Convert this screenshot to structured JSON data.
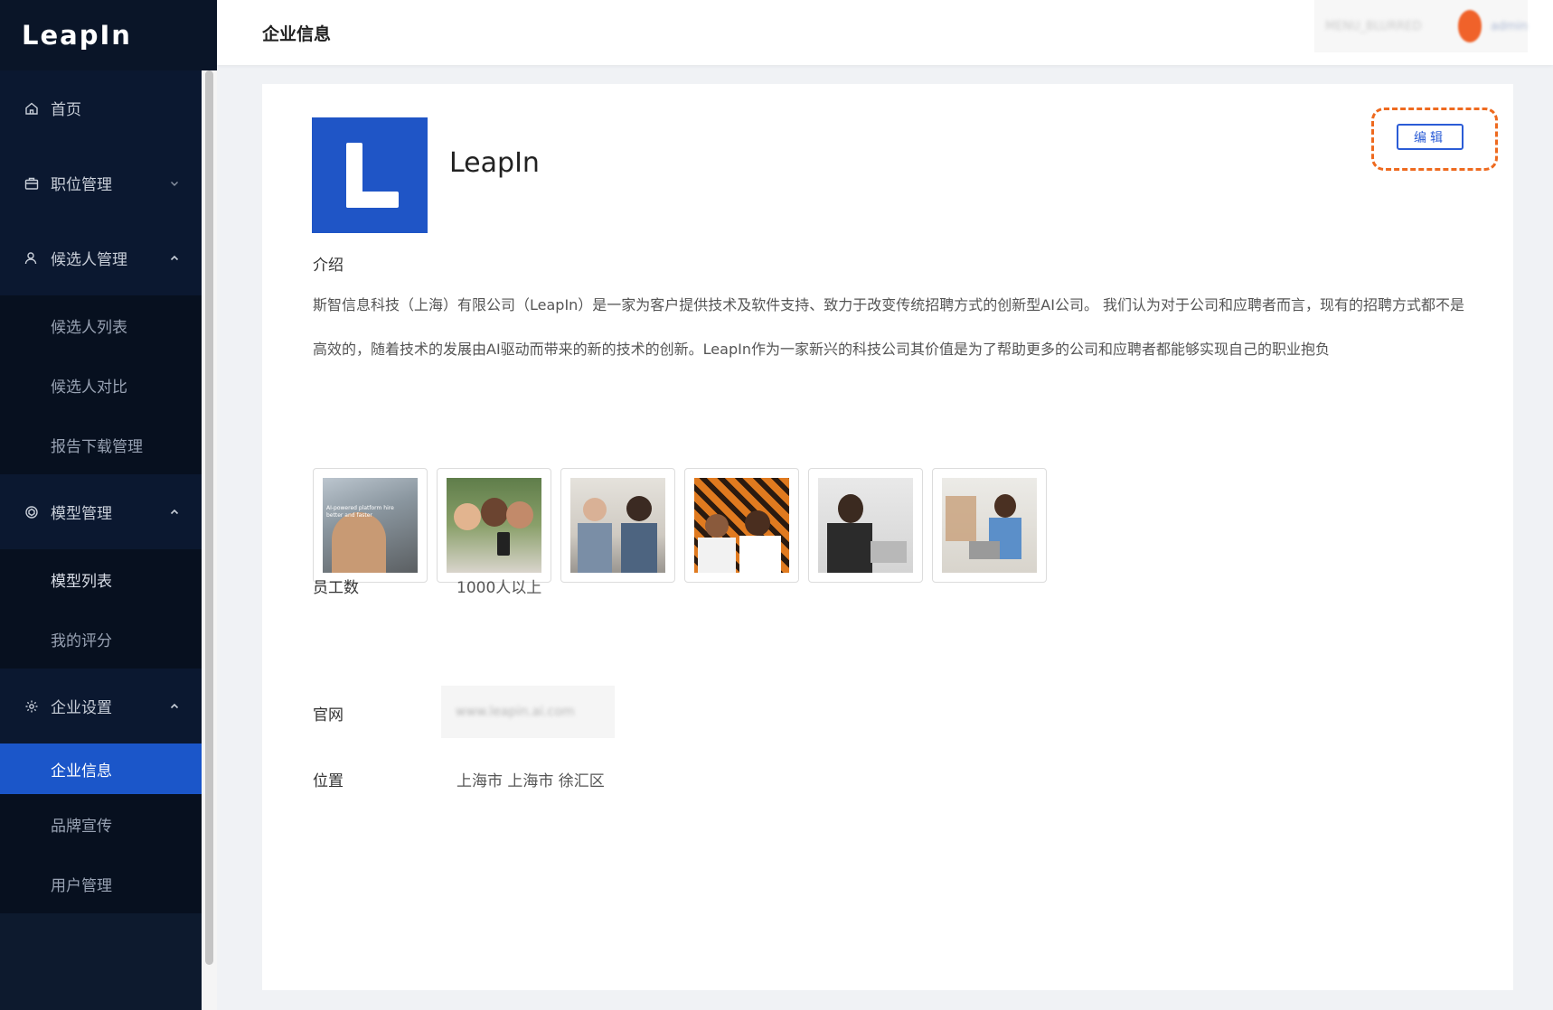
{
  "app": {
    "logo": "LeapIn"
  },
  "sidebar": {
    "items": [
      {
        "label": "首页"
      },
      {
        "label": "职位管理"
      },
      {
        "label": "候选人管理",
        "children": [
          "候选人列表",
          "候选人对比",
          "报告下载管理"
        ]
      },
      {
        "label": "模型管理",
        "children": [
          "模型列表",
          "我的评分"
        ]
      },
      {
        "label": "企业设置",
        "children": [
          "企业信息",
          "品牌宣传",
          "用户管理"
        ]
      }
    ]
  },
  "header": {
    "title": "企业信息",
    "right_text": "MENU_BLURRED",
    "user_text": "admin"
  },
  "company": {
    "name": "LeapIn",
    "edit_label": "编辑",
    "intro_label": "介绍",
    "intro": "斯智信息科技（上海）有限公司（LeapIn）是一家为客户提供技术及软件支持、致力于改变传统招聘方式的创新型AI公司。 我们认为对于公司和应聘者而言，现有的招聘方式都不是高效的，随着技术的发展由AI驱动而带来的新的技术的创新。LeapIn作为一家新兴的科技公司其价值是为了帮助更多的公司和应聘者都能够实现自己的职业抱负",
    "photo_caption": "AI-powered platform hire better and faster",
    "employees_label": "员工数",
    "employees_value": "1000人以上",
    "website_label": "官网",
    "website_value": "www.leapin.ai.com",
    "location_label": "位置",
    "location_value": "上海市 上海市 徐汇区"
  },
  "colors": {
    "sidebar_bg": "#0d1a2e",
    "active_item": "#1b56c9",
    "brand_blue": "#1f55c6",
    "highlight_orange": "#ee6a1f"
  }
}
